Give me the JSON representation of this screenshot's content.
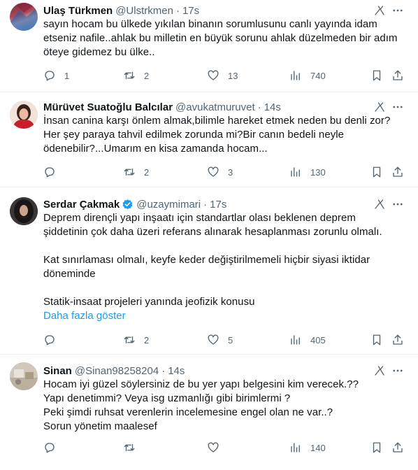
{
  "tweets": [
    {
      "name": "Ulaş Türkmen",
      "handle": "@Ulstrkmen",
      "time": "17s",
      "verified": false,
      "lines": [
        "sayın hocam bu ülkede yıkılan binanın sorumlusunu canlı yayında idam",
        "etseniz nafile..ahlak bu milletin en büyük sorunu ahlak düzelmeden bir adım",
        "öteye gidemez bu ülke.."
      ],
      "show_more": "",
      "replies": "1",
      "retweets": "2",
      "likes": "13",
      "views": "740"
    },
    {
      "name": "Mürüvet Suatoğlu Balcılar",
      "handle": "@avukatmuruvet",
      "time": "14s",
      "verified": false,
      "lines": [
        "İnsan canina karşı önlem almak,bilimle hareket etmek neden bu denli zor?",
        "Her şey paraya tahvil edilmek zorunda mi?Bir canın bedeli neyle",
        "ödenebilir?...Umarım en kisa zamanda hocam..."
      ],
      "show_more": "",
      "replies": "",
      "retweets": "2",
      "likes": "3",
      "views": "130"
    },
    {
      "name": "Serdar Çakmak",
      "handle": "@uzaymimari",
      "time": "17s",
      "verified": true,
      "lines": [
        "Deprem dirençli yapı inşaatı için standartlar olası beklenen deprem",
        "şiddetinin çok daha üzeri referans alınarak hesaplanması zorunlu olmalı.",
        "",
        "Kat sınırlaması olmalı, keyfe keder değiştirilmemeli hiçbir siyasi iktidar",
        "döneminde",
        "",
        "Statik-insaat projeleri yanında jeofizik konusu"
      ],
      "show_more": "Daha fazla göster",
      "replies": "",
      "retweets": "2",
      "likes": "5",
      "views": "405"
    },
    {
      "name": "Sinan",
      "handle": "@Sinan98258204",
      "time": "14s",
      "verified": false,
      "lines": [
        "Hocam iyi güzel söylersiniz de bu yer yapı belgesini kim verecek.??",
        "Yapı denetimmi? Veya isg uzmanlığı gibi birimlermi ?",
        "Peki şimdi ruhsat verenlerin incelemesine engel olan ne var..?",
        "Sorun yönetim  maalesef"
      ],
      "show_more": "",
      "replies": "",
      "retweets": "",
      "likes": "",
      "views": "140"
    }
  ],
  "colors": {
    "text": "#0f1419",
    "secondary": "#536471",
    "link": "#1d9bf0",
    "verified": "#1d9bf0",
    "divider": "#eff3f4"
  },
  "icons": {
    "reply": "reply-icon",
    "retweet": "retweet-icon",
    "like": "heart-icon",
    "views": "views-icon",
    "bookmark": "bookmark-icon",
    "share": "share-icon",
    "grok": "grok-icon",
    "more": "more-icon"
  }
}
